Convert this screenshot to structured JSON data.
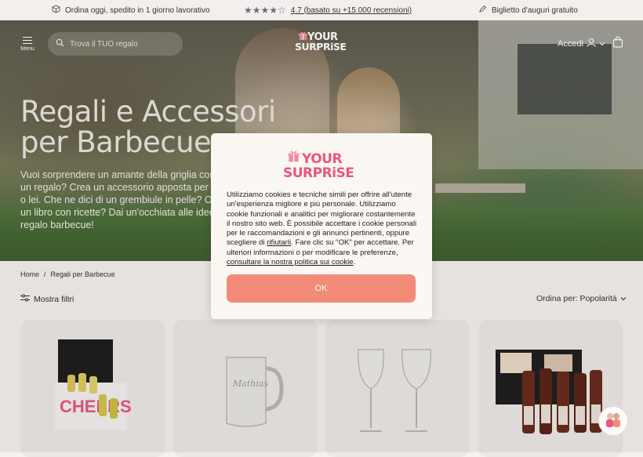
{
  "topbar": {
    "shipping": "Ordina oggi, spedito in 1 giorno lavorativo",
    "rating": "4.7 (basato su +15.000 recensioni)",
    "rating_value": 4.7,
    "card": "Biglietto d'auguri gratuito"
  },
  "header": {
    "menu_label": "Menu",
    "search_placeholder": "Trova il TUO regalo",
    "logo_line1": "YOUR",
    "logo_line2": "SURPRiSE",
    "login_label": "Accedi"
  },
  "hero": {
    "title": "Regali e Accessori per Barbecue",
    "description": "Vuoi sorprendere un amante della griglia con un regalo? Crea un accessorio apposta per lui o lei. Che ne dici di un grembiule in pelle? O di un libro con ricette? Dai un'occhiata alle idee regalo barbecue!"
  },
  "breadcrumb": {
    "home": "Home",
    "separator": "/",
    "current": "Regali per Barbecue"
  },
  "toolbar": {
    "filters_label": "Mostra filtri",
    "sort_label": "Ordina per: Popolarità"
  },
  "products": [
    {
      "name": "set shot personalizzati"
    },
    {
      "name": "boccale birra inciso"
    },
    {
      "name": "calici vino incisi"
    },
    {
      "name": "set birre con foto"
    }
  ],
  "cookie_dialog": {
    "logo_line1": "YOUR",
    "logo_line2": "SURPRiSE",
    "text_before_refuse": "Utilizziamo cookies e tecniche simili per offrire all'utente un'esperienza migliore e più personale. Utilizziamo cookie funzionali e analitici per migliorare costantemente il nostro sito web. È possibile accettare i cookie personali per le raccomandazioni e gli annunci pertinenti, oppure scegliere di ",
    "refuse_link": "rifiutarli",
    "text_middle": ". Fare clic su \"OK\" per accettare. Per ulteriori informazioni o per modificare le preferenze, ",
    "policy_link": "consultare la nostra politica sui cookie",
    "text_end": ".",
    "ok_label": "OK"
  },
  "colors": {
    "accent": "#f28b78",
    "brand_pink": "#e8587a",
    "background": "#f4f1ee"
  }
}
